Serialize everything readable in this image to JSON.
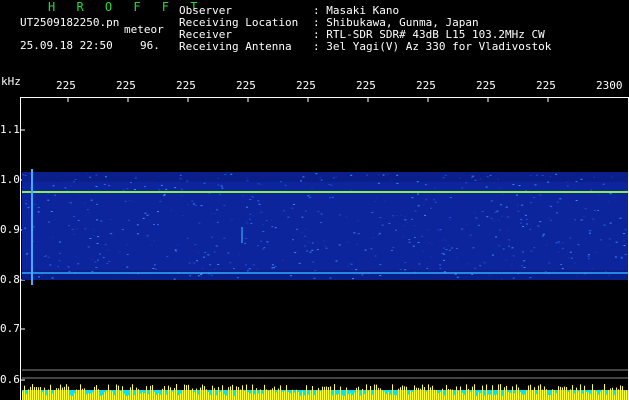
{
  "app": {
    "title": "H R O F F T"
  },
  "file": {
    "name": "UT2509182250.pn",
    "type": "meteor",
    "datetime": "25.09.18 22:50",
    "count": "96."
  },
  "header": [
    {
      "label": "Observer",
      "value": ": Masaki Kano"
    },
    {
      "label": "Receiving Location",
      "value": ": Shibukawa, Gunma, Japan"
    },
    {
      "label": "Receiver",
      "value": ": RTL-SDR SDR# 43dB L15 103.2MHz CW"
    },
    {
      "label": "Receiving Antenna",
      "value": ": 3el Yagi(V) Az 330 for Vladivostok"
    }
  ],
  "axes": {
    "y_unit": "kHz",
    "y_ticks": [
      "1.1",
      "1.0",
      "0.9",
      "0.8",
      "0.7",
      "0.6"
    ],
    "x_ticks": [
      "225",
      "225",
      "225",
      "225",
      "225",
      "225",
      "225",
      "225",
      "225",
      "2300"
    ]
  },
  "colors": {
    "title": "#22dd33",
    "band": "#0a1f8a",
    "cyan": "#00e5ff",
    "yellow": "#ffff33"
  }
}
